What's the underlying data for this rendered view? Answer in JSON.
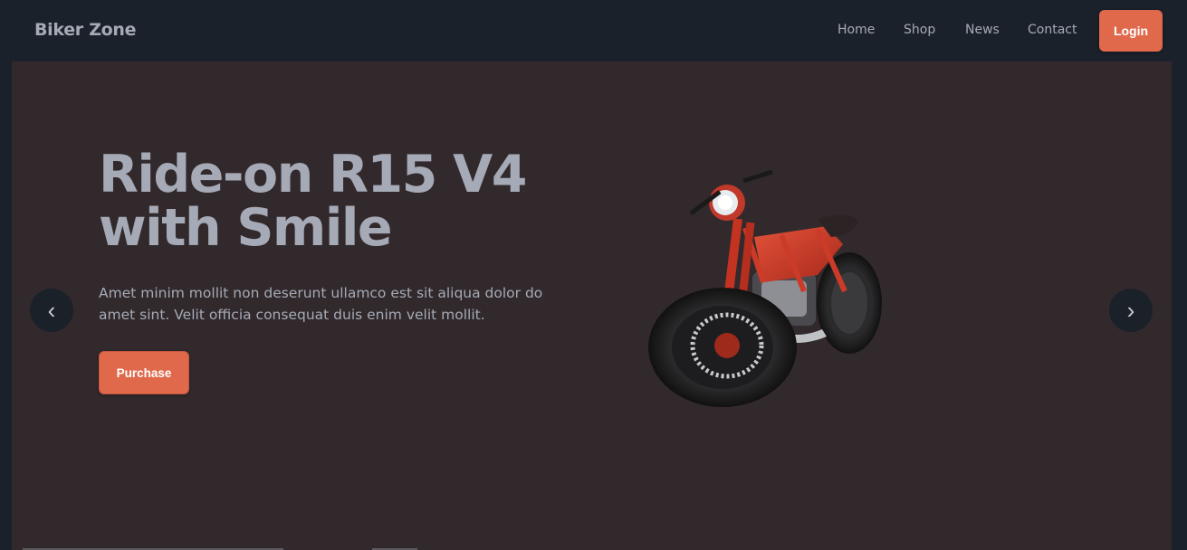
{
  "brand": {
    "name": "Biker Zone"
  },
  "nav": {
    "items": [
      {
        "label": "Home"
      },
      {
        "label": "Shop"
      },
      {
        "label": "News"
      },
      {
        "label": "Contact"
      }
    ],
    "login_label": "Login"
  },
  "hero": {
    "title_line1": "Ride-on R15 V4",
    "title_line2": "with Smile",
    "description": "Amet minim mollit non deserunt ullamco est sit aliqua dolor do amet sint. Velit officia consequat duis enim velit mollit.",
    "cta_label": "Purchase",
    "prev_arrow": "‹",
    "next_arrow": "›"
  },
  "colors": {
    "accent": "#e0694c",
    "nav_background": "#1b212a",
    "hero_background": "#32292c",
    "text_muted": "#a5aab6"
  },
  "icons": {
    "prev": "chevron-left-icon",
    "next": "chevron-right-icon",
    "product": "motorcycle-image"
  }
}
